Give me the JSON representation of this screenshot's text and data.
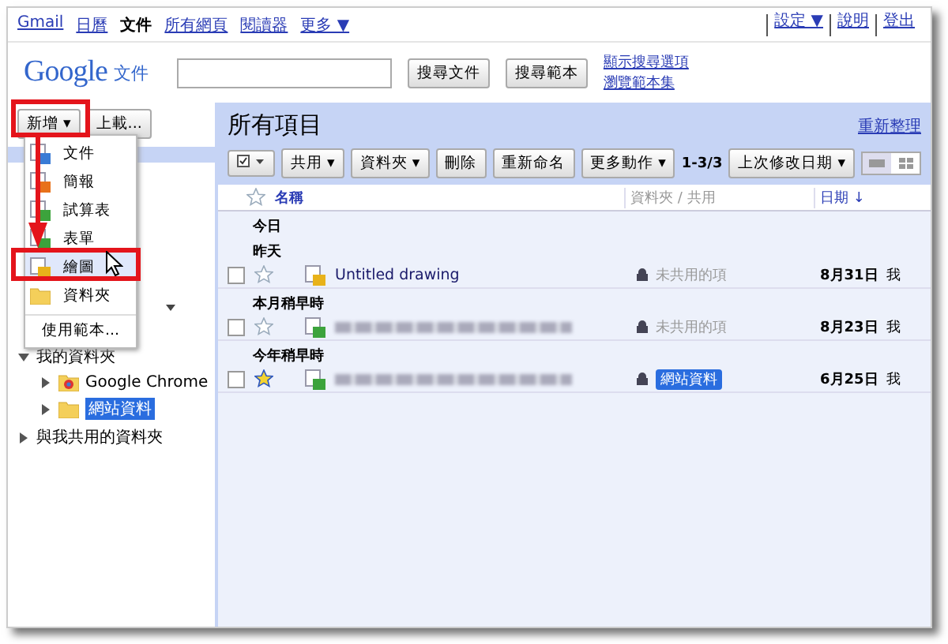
{
  "top_nav": {
    "links": [
      {
        "label": "Gmail",
        "selected": false
      },
      {
        "label": "日曆",
        "selected": false
      },
      {
        "label": "文件",
        "selected": true
      },
      {
        "label": "所有網頁",
        "selected": false
      },
      {
        "label": "閱讀器",
        "selected": false
      },
      {
        "label": "更多 ▼",
        "selected": false
      }
    ],
    "right_links": [
      "設定 ▼",
      "說明",
      "登出"
    ]
  },
  "header": {
    "logo": "Google",
    "product": "文件",
    "search_buttons": [
      "搜尋文件",
      "搜尋範本"
    ],
    "search_links": [
      "顯示搜尋選項",
      "瀏覽範本集"
    ]
  },
  "sidebar": {
    "new_button": "新增 ▾",
    "upload_button": "上載...",
    "new_menu": [
      {
        "kind": "doc",
        "label": "文件",
        "selected": false
      },
      {
        "kind": "slides",
        "label": "簡報",
        "selected": false
      },
      {
        "kind": "sheet",
        "label": "試算表",
        "selected": false
      },
      {
        "kind": "form",
        "label": "表單",
        "selected": false
      },
      {
        "kind": "drawing",
        "label": "繪圖",
        "selected": true
      },
      {
        "kind": "folder",
        "label": "資料夾",
        "selected": false
      },
      {
        "kind": "template",
        "label": "使用範本...",
        "selected": false
      }
    ],
    "tree": [
      {
        "label": "我的資料夾",
        "expanded": true,
        "selected": false,
        "children": [
          {
            "label": "Google Chrome",
            "kind": "chrome",
            "expanded": false,
            "selected": false
          },
          {
            "label": "網站資料",
            "kind": "folder",
            "expanded": false,
            "selected": true
          }
        ]
      },
      {
        "label": "與我共用的資料夾",
        "expanded": false,
        "selected": false
      }
    ]
  },
  "main": {
    "title": "所有項目",
    "refresh": "重新整理",
    "toolbar": [
      "共用 ▾",
      "資料夾 ▾",
      "刪除",
      "重新命名",
      "更多動作 ▾"
    ],
    "count": "1-3/3",
    "sort": "上次修改日期 ▾",
    "view_modes": [
      {
        "kind": "list",
        "selected": true
      },
      {
        "kind": "grid",
        "selected": false
      }
    ],
    "columns": {
      "name": "名稱",
      "folders": "資料夾 / 共用",
      "date": "日期 ↓"
    },
    "groups": [
      {
        "label": "今日"
      },
      {
        "label": "昨天",
        "rows": [
          {
            "kind": "drawing",
            "checked": false,
            "title": "Untitled drawing",
            "starred": false,
            "sharing": "未共用的項",
            "date": "8月31日",
            "owner": "我"
          }
        ]
      },
      {
        "label": "本月稍早時",
        "rows": [
          {
            "kind": "form",
            "checked": false,
            "starred": false,
            "sharing": "未共用的項",
            "date": "8月23日",
            "owner": "我"
          }
        ]
      },
      {
        "label": "今年稍早時",
        "rows": [
          {
            "kind": "form",
            "checked": false,
            "starred": true,
            "folder_tag": "網站資料",
            "date": "6月25日",
            "owner": "我"
          }
        ]
      }
    ]
  }
}
